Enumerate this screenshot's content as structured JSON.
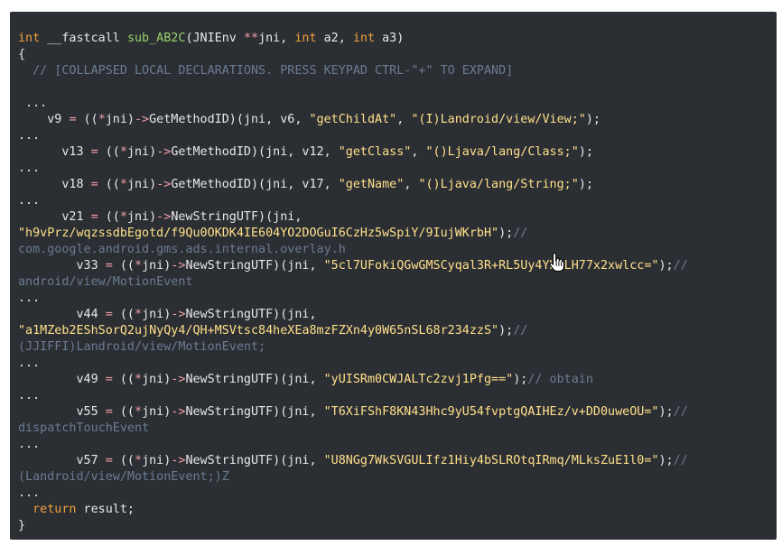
{
  "lines": [
    [
      {
        "c": "kw",
        "t": "int"
      },
      {
        "c": "",
        "t": " __fastcall "
      },
      {
        "c": "fn",
        "t": "sub_AB2C"
      },
      {
        "c": "",
        "t": "(JNIEnv "
      },
      {
        "c": "op",
        "t": "**"
      },
      {
        "c": "",
        "t": "jni, "
      },
      {
        "c": "kw",
        "t": "int"
      },
      {
        "c": "",
        "t": " a2, "
      },
      {
        "c": "kw",
        "t": "int"
      },
      {
        "c": "",
        "t": " a3)"
      }
    ],
    [
      {
        "c": "",
        "t": "{"
      }
    ],
    [
      {
        "c": "cm",
        "t": "  // [COLLAPSED LOCAL DECLARATIONS. PRESS KEYPAD CTRL-\"+\" TO EXPAND]"
      }
    ],
    [],
    [
      {
        "c": "",
        "t": " ..."
      }
    ],
    [
      {
        "c": "",
        "t": "    v9 "
      },
      {
        "c": "op",
        "t": "="
      },
      {
        "c": "",
        "t": " (("
      },
      {
        "c": "op",
        "t": "*"
      },
      {
        "c": "",
        "t": "jni)"
      },
      {
        "c": "op",
        "t": "->"
      },
      {
        "c": "",
        "t": "GetMethodID)(jni, v6, "
      },
      {
        "c": "str",
        "t": "\"getChildAt\""
      },
      {
        "c": "",
        "t": ", "
      },
      {
        "c": "str",
        "t": "\"(I)Landroid/view/View;\""
      },
      {
        "c": "",
        "t": ");"
      }
    ],
    [
      {
        "c": "",
        "t": "..."
      }
    ],
    [
      {
        "c": "",
        "t": "      v13 "
      },
      {
        "c": "op",
        "t": "="
      },
      {
        "c": "",
        "t": " (("
      },
      {
        "c": "op",
        "t": "*"
      },
      {
        "c": "",
        "t": "jni)"
      },
      {
        "c": "op",
        "t": "->"
      },
      {
        "c": "",
        "t": "GetMethodID)(jni, v12, "
      },
      {
        "c": "str",
        "t": "\"getClass\""
      },
      {
        "c": "",
        "t": ", "
      },
      {
        "c": "str",
        "t": "\"()Ljava/lang/Class;\""
      },
      {
        "c": "",
        "t": ");"
      }
    ],
    [
      {
        "c": "",
        "t": "..."
      }
    ],
    [
      {
        "c": "",
        "t": "      v18 "
      },
      {
        "c": "op",
        "t": "="
      },
      {
        "c": "",
        "t": " (("
      },
      {
        "c": "op",
        "t": "*"
      },
      {
        "c": "",
        "t": "jni)"
      },
      {
        "c": "op",
        "t": "->"
      },
      {
        "c": "",
        "t": "GetMethodID)(jni, v17, "
      },
      {
        "c": "str",
        "t": "\"getName\""
      },
      {
        "c": "",
        "t": ", "
      },
      {
        "c": "str",
        "t": "\"()Ljava/lang/String;\""
      },
      {
        "c": "",
        "t": ");"
      }
    ],
    [
      {
        "c": "",
        "t": "..."
      }
    ],
    [
      {
        "c": "",
        "t": "      v21 "
      },
      {
        "c": "op",
        "t": "="
      },
      {
        "c": "",
        "t": " (("
      },
      {
        "c": "op",
        "t": "*"
      },
      {
        "c": "",
        "t": "jni)"
      },
      {
        "c": "op",
        "t": "->"
      },
      {
        "c": "",
        "t": "NewStringUTF)(jni,"
      }
    ],
    [
      {
        "c": "str",
        "t": "\"h9vPrz/wqzssdbEgotd/f9Qu0OKDK4IE604YO2DOGuI6CzHz5wSpiY/9IujWKrbH\""
      },
      {
        "c": "",
        "t": ");"
      },
      {
        "c": "cm",
        "t": "//"
      }
    ],
    [
      {
        "c": "cm",
        "t": "com.google.android.gms.ads.internal.overlay.h"
      }
    ],
    [
      {
        "c": "",
        "t": "        v33 "
      },
      {
        "c": "op",
        "t": "="
      },
      {
        "c": "",
        "t": " (("
      },
      {
        "c": "op",
        "t": "*"
      },
      {
        "c": "",
        "t": "jni)"
      },
      {
        "c": "op",
        "t": "->"
      },
      {
        "c": "",
        "t": "NewStringUTF)(jni, "
      },
      {
        "c": "str",
        "t": "\"5cl7UFokiQGwGMSCyqal3R+RL5Uy4YKJLH77x2xwlcc=\""
      },
      {
        "c": "",
        "t": ");"
      },
      {
        "c": "cm",
        "t": "//"
      }
    ],
    [
      {
        "c": "cm",
        "t": "android/view/MotionEvent"
      }
    ],
    [
      {
        "c": "",
        "t": "..."
      }
    ],
    [
      {
        "c": "",
        "t": "        v44 "
      },
      {
        "c": "op",
        "t": "="
      },
      {
        "c": "",
        "t": " (("
      },
      {
        "c": "op",
        "t": "*"
      },
      {
        "c": "",
        "t": "jni)"
      },
      {
        "c": "op",
        "t": "->"
      },
      {
        "c": "",
        "t": "NewStringUTF)(jni,"
      }
    ],
    [
      {
        "c": "str",
        "t": "\"a1MZeb2EShSorQ2ujNyQy4/QH+MSVtsc84heXEa8mzFZXn4y0W65nSL68r234zzS\""
      },
      {
        "c": "",
        "t": ");"
      },
      {
        "c": "cm",
        "t": "//"
      }
    ],
    [
      {
        "c": "cm",
        "t": "(JJIFFI)Landroid/view/MotionEvent;"
      }
    ],
    [
      {
        "c": "",
        "t": "..."
      }
    ],
    [
      {
        "c": "",
        "t": "        v49 "
      },
      {
        "c": "op",
        "t": "="
      },
      {
        "c": "",
        "t": " (("
      },
      {
        "c": "op",
        "t": "*"
      },
      {
        "c": "",
        "t": "jni)"
      },
      {
        "c": "op",
        "t": "->"
      },
      {
        "c": "",
        "t": "NewStringUTF)(jni, "
      },
      {
        "c": "str",
        "t": "\"yUISRm0CWJALTc2zvj1Pfg==\""
      },
      {
        "c": "",
        "t": ");"
      },
      {
        "c": "cm",
        "t": "// obtain"
      }
    ],
    [
      {
        "c": "",
        "t": "..."
      }
    ],
    [
      {
        "c": "",
        "t": "        v55 "
      },
      {
        "c": "op",
        "t": "="
      },
      {
        "c": "",
        "t": " (("
      },
      {
        "c": "op",
        "t": "*"
      },
      {
        "c": "",
        "t": "jni)"
      },
      {
        "c": "op",
        "t": "->"
      },
      {
        "c": "",
        "t": "NewStringUTF)(jni, "
      },
      {
        "c": "str",
        "t": "\"T6XiFShF8KN43Hhc9yU54fvptgQAIHEz/v+DD0uweOU=\""
      },
      {
        "c": "",
        "t": ");"
      },
      {
        "c": "cm",
        "t": "//"
      }
    ],
    [
      {
        "c": "cm",
        "t": "dispatchTouchEvent"
      }
    ],
    [
      {
        "c": "",
        "t": "..."
      }
    ],
    [
      {
        "c": "",
        "t": "        v57 "
      },
      {
        "c": "op",
        "t": "="
      },
      {
        "c": "",
        "t": " (("
      },
      {
        "c": "op",
        "t": "*"
      },
      {
        "c": "",
        "t": "jni)"
      },
      {
        "c": "op",
        "t": "->"
      },
      {
        "c": "",
        "t": "NewStringUTF)(jni, "
      },
      {
        "c": "str",
        "t": "\"U8NGg7WkSVGULIfz1Hiy4bSLROtqIRmq/MLksZuE1l0=\""
      },
      {
        "c": "",
        "t": ");"
      },
      {
        "c": "cm",
        "t": "//"
      }
    ],
    [
      {
        "c": "cm",
        "t": "(Landroid/view/MotionEvent;)Z"
      }
    ],
    [
      {
        "c": "",
        "t": "..."
      }
    ],
    [
      {
        "c": "",
        "t": "  "
      },
      {
        "c": "kw",
        "t": "return"
      },
      {
        "c": "",
        "t": " result;"
      }
    ],
    [
      {
        "c": "",
        "t": "}"
      }
    ]
  ],
  "icons": {
    "cursor": "hand-pointer-icon"
  },
  "colors": {
    "background": "#2b2e33",
    "text": "#e6e8ea",
    "keyword": "#f1a03c",
    "function": "#9ad36a",
    "operator": "#f2a0a8",
    "string": "#ffe08a",
    "comment": "#6b7c92"
  }
}
